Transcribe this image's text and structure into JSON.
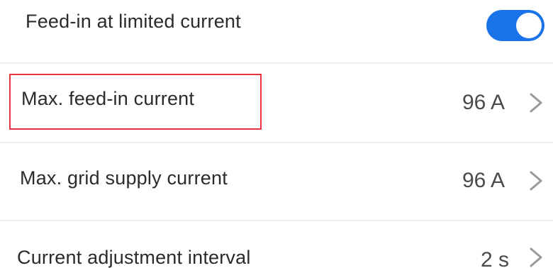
{
  "settings": {
    "feed_in_limited": {
      "label": "Feed-in at limited current",
      "enabled": true
    },
    "max_feed_in": {
      "label": "Max. feed-in current",
      "value": "96 A"
    },
    "max_grid_supply": {
      "label": "Max. grid supply current",
      "value": "96 A"
    },
    "adjustment_interval": {
      "label": "Current adjustment interval",
      "value": "2 s"
    }
  },
  "colors": {
    "toggle_on": "#1a73e8",
    "highlight_border": "#e8323c"
  },
  "icons": {
    "row_arrow": "chevron-right-icon"
  }
}
